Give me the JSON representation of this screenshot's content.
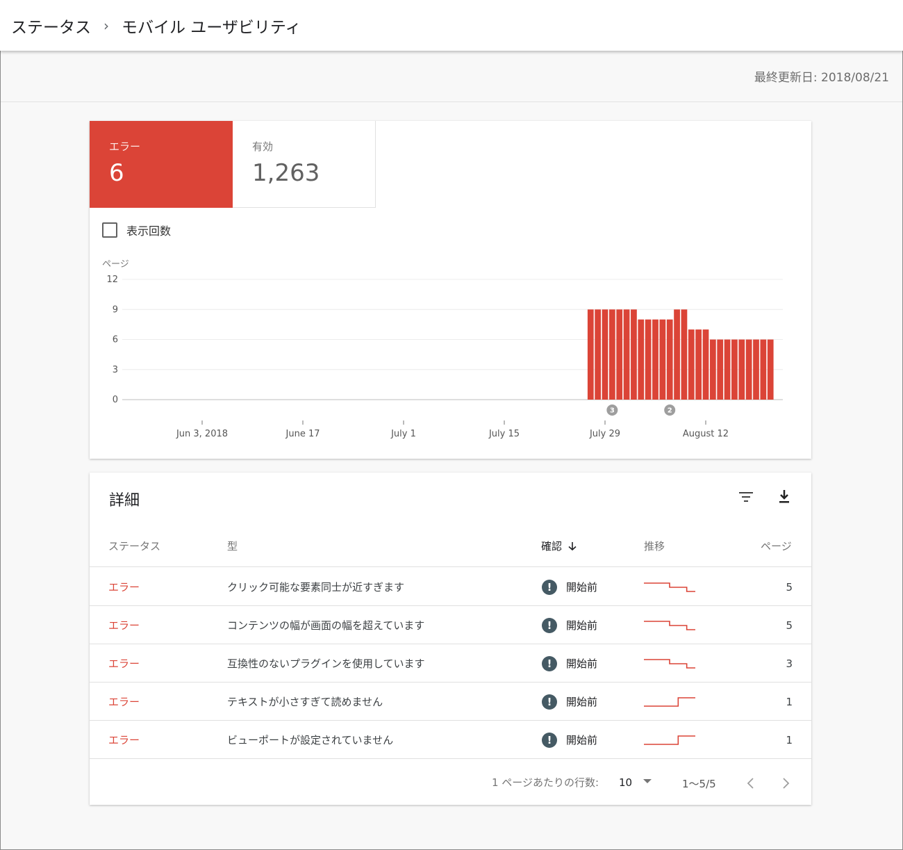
{
  "breadcrumb": {
    "root": "ステータス",
    "separator": "›",
    "current": "モバイル ユーザビリティ"
  },
  "updated": "最終更新日: 2018/08/21",
  "summary": {
    "error": {
      "label": "エラー",
      "value": "6"
    },
    "valid": {
      "label": "有効",
      "value": "1,263"
    }
  },
  "impressions_label": "表示回数",
  "chart_data": {
    "type": "bar",
    "ylabel": "ページ",
    "ylim": [
      0,
      12
    ],
    "yticks": [
      "0",
      "3",
      "6",
      "9",
      "12"
    ],
    "xticks": [
      {
        "label": "Jun 3, 2018",
        "date": "2018-06-03"
      },
      {
        "label": "June 17",
        "date": "2018-06-17"
      },
      {
        "label": "July 1",
        "date": "2018-07-01"
      },
      {
        "label": "July 15",
        "date": "2018-07-15"
      },
      {
        "label": "July 29",
        "date": "2018-07-29"
      },
      {
        "label": "August 12",
        "date": "2018-08-12"
      }
    ],
    "bars": [
      {
        "date": "2018-07-27",
        "value": 9
      },
      {
        "date": "2018-07-28",
        "value": 9
      },
      {
        "date": "2018-07-29",
        "value": 9
      },
      {
        "date": "2018-07-30",
        "value": 9
      },
      {
        "date": "2018-07-31",
        "value": 9
      },
      {
        "date": "2018-08-01",
        "value": 9
      },
      {
        "date": "2018-08-02",
        "value": 9
      },
      {
        "date": "2018-08-03",
        "value": 8
      },
      {
        "date": "2018-08-04",
        "value": 8
      },
      {
        "date": "2018-08-05",
        "value": 8
      },
      {
        "date": "2018-08-06",
        "value": 8
      },
      {
        "date": "2018-08-07",
        "value": 8
      },
      {
        "date": "2018-08-08",
        "value": 9
      },
      {
        "date": "2018-08-09",
        "value": 9
      },
      {
        "date": "2018-08-10",
        "value": 7
      },
      {
        "date": "2018-08-11",
        "value": 7
      },
      {
        "date": "2018-08-12",
        "value": 7
      },
      {
        "date": "2018-08-13",
        "value": 6
      },
      {
        "date": "2018-08-14",
        "value": 6
      },
      {
        "date": "2018-08-15",
        "value": 6
      },
      {
        "date": "2018-08-16",
        "value": 6
      },
      {
        "date": "2018-08-17",
        "value": 6
      },
      {
        "date": "2018-08-18",
        "value": 6
      },
      {
        "date": "2018-08-19",
        "value": 6
      },
      {
        "date": "2018-08-20",
        "value": 6
      },
      {
        "date": "2018-08-21",
        "value": 6
      }
    ],
    "annotations": [
      {
        "date": "2018-07-30",
        "label": "3"
      },
      {
        "date": "2018-08-07",
        "label": "2"
      }
    ],
    "bar_color": "#db4437"
  },
  "details": {
    "title": "詳細",
    "columns": {
      "status": "ステータス",
      "type": "型",
      "confirm": "確認",
      "trend": "推移",
      "pages": "ページ"
    },
    "rows": [
      {
        "status": "エラー",
        "type": "クリック可能な要素同士が近すぎます",
        "confirm": "開始前",
        "pages": "5",
        "trend": [
          3,
          3,
          3,
          2,
          2,
          1,
          1
        ]
      },
      {
        "status": "エラー",
        "type": "コンテンツの幅が画面の幅を超えています",
        "confirm": "開始前",
        "pages": "5",
        "trend": [
          3,
          3,
          3,
          2,
          2,
          1,
          1
        ]
      },
      {
        "status": "エラー",
        "type": "互換性のないプラグインを使用しています",
        "confirm": "開始前",
        "pages": "3",
        "trend": [
          3,
          3,
          3,
          2,
          2,
          1,
          1
        ]
      },
      {
        "status": "エラー",
        "type": "テキストが小さすぎて読めません",
        "confirm": "開始前",
        "pages": "1",
        "trend": [
          1,
          1,
          1,
          1,
          2,
          2,
          2
        ]
      },
      {
        "status": "エラー",
        "type": "ビューポートが設定されていません",
        "confirm": "開始前",
        "pages": "1",
        "trend": [
          1,
          1,
          1,
          1,
          2,
          2,
          2
        ]
      }
    ],
    "footer": {
      "rows_per_page_label": "1 ページあたりの行数:",
      "rows_per_page": "10",
      "range": "1～5/5"
    },
    "error_color": "#db4437"
  }
}
